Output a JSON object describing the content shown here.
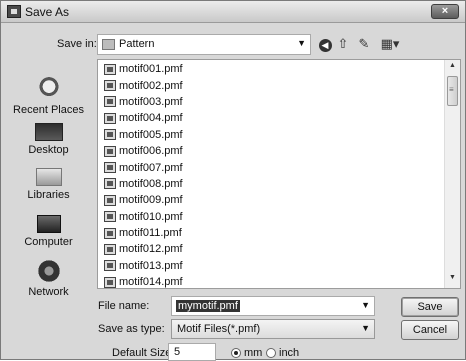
{
  "window": {
    "title": "Save As",
    "close_label": "×"
  },
  "toolbar": {
    "save_in_label": "Save in:",
    "save_in_value": "Pattern",
    "icons": [
      "back-icon",
      "up-folder-icon",
      "new-folder-icon",
      "views-menu-icon"
    ]
  },
  "places": [
    {
      "label": "Recent Places",
      "icon": "recent-places-icon"
    },
    {
      "label": "Desktop",
      "icon": "desktop-icon"
    },
    {
      "label": "Libraries",
      "icon": "libraries-icon"
    },
    {
      "label": "Computer",
      "icon": "computer-icon"
    },
    {
      "label": "Network",
      "icon": "network-icon"
    }
  ],
  "files": [
    "motif001.pmf",
    "motif002.pmf",
    "motif003.pmf",
    "motif004.pmf",
    "motif005.pmf",
    "motif006.pmf",
    "motif007.pmf",
    "motif008.pmf",
    "motif009.pmf",
    "motif010.pmf",
    "motif011.pmf",
    "motif012.pmf",
    "motif013.pmf",
    "motif014.pmf"
  ],
  "form": {
    "file_name_label": "File name:",
    "file_name_value": "mymotif.pmf",
    "save_type_label": "Save as type:",
    "save_type_value": "Motif Files(*.pmf)",
    "save_button": "Save",
    "cancel_button": "Cancel",
    "default_size_label": "Default Size",
    "default_size_value": "5",
    "unit_mm": "mm",
    "unit_inch": "inch",
    "selected_unit": "mm"
  },
  "colors": {
    "dialog_bg": "#d8d8d8",
    "list_bg": "#ffffff",
    "selection": "#333333"
  }
}
